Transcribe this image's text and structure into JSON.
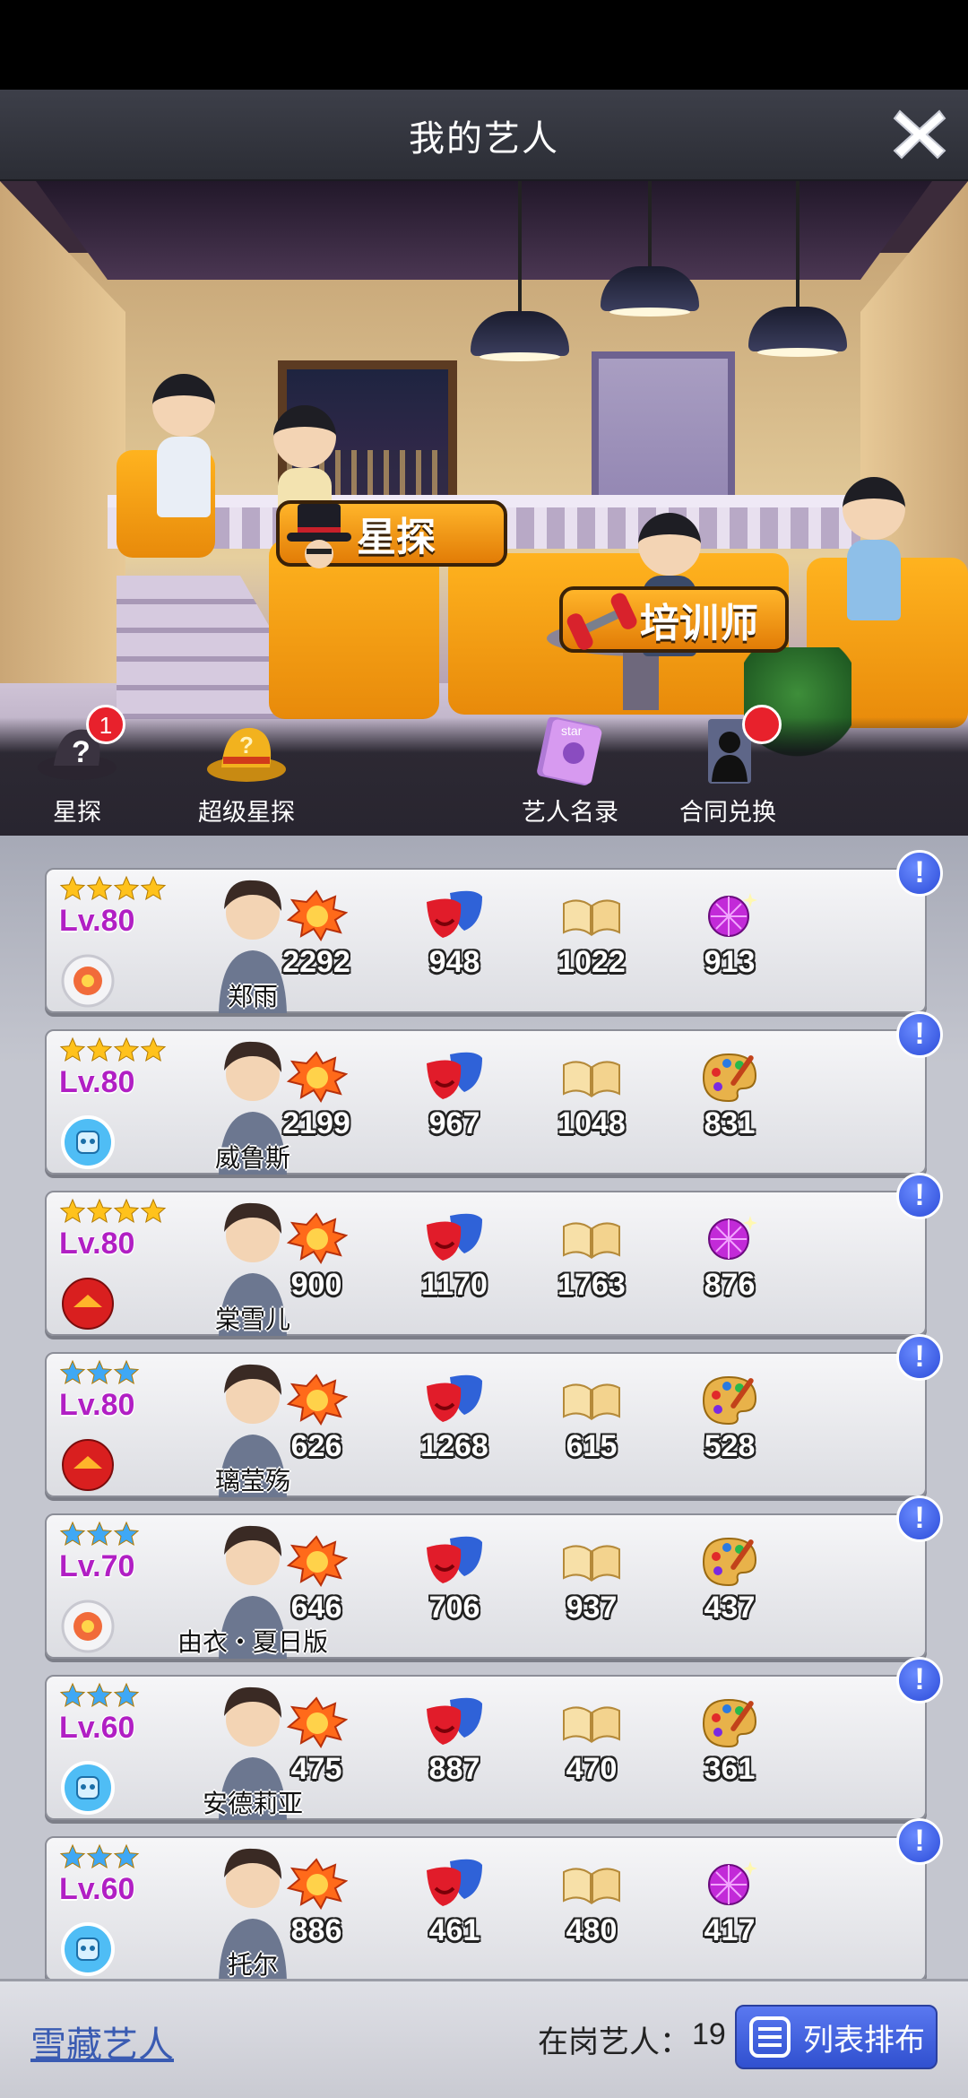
{
  "header": {
    "title": "我的艺人"
  },
  "scene": {
    "signs": [
      {
        "label": "星探",
        "icon": "top-hat-icon"
      },
      {
        "label": "培训师",
        "icon": "dumbbell-icon"
      }
    ]
  },
  "actions": [
    {
      "label": "星探",
      "icon": "question-hat-icon",
      "badge": "1"
    },
    {
      "label": "超级星探",
      "icon": "gold-hat-icon",
      "badge": ""
    },
    {
      "label": "艺人名录",
      "icon": "star-book-icon",
      "badge": ""
    },
    {
      "label": "合同兑换",
      "icon": "silhouette-card-icon",
      "badge": ""
    }
  ],
  "stat_icons": [
    "explosion-icon",
    "drama-mask-icon",
    "open-book-icon",
    "talent-icon"
  ],
  "artists": [
    {
      "name": "郑雨",
      "level": "Lv.80",
      "stars": 4,
      "star_color": "#ffc21c",
      "type": "flower",
      "stats": [
        "2292",
        "948",
        "1022",
        "913"
      ],
      "talent_icon": "disco-ball-icon"
    },
    {
      "name": "威鲁斯",
      "level": "Lv.80",
      "stars": 4,
      "star_color": "#ffc21c",
      "type": "robot",
      "stats": [
        "2199",
        "967",
        "1048",
        "831"
      ],
      "talent_icon": "palette-icon"
    },
    {
      "name": "棠雪儿",
      "level": "Lv.80",
      "stars": 4,
      "star_color": "#ffc21c",
      "type": "red",
      "stats": [
        "900",
        "1170",
        "1763",
        "876"
      ],
      "talent_icon": "disco-ball-icon"
    },
    {
      "name": "璃莹殇",
      "level": "Lv.80",
      "stars": 3,
      "star_color": "#3fa8f5",
      "type": "red",
      "stats": [
        "626",
        "1268",
        "615",
        "528"
      ],
      "talent_icon": "palette-icon"
    },
    {
      "name": "由衣・夏日版",
      "level": "Lv.70",
      "stars": 3,
      "star_color": "#3fa8f5",
      "type": "flower",
      "stats": [
        "646",
        "706",
        "937",
        "437"
      ],
      "talent_icon": "palette-icon"
    },
    {
      "name": "安德莉亚",
      "level": "Lv.60",
      "stars": 3,
      "star_color": "#3fa8f5",
      "type": "robot",
      "stats": [
        "475",
        "887",
        "470",
        "361"
      ],
      "talent_icon": "palette-icon"
    },
    {
      "name": "托尔",
      "level": "Lv.60",
      "stars": 3,
      "star_color": "#3fa8f5",
      "type": "robot",
      "stats": [
        "886",
        "461",
        "480",
        "417"
      ],
      "talent_icon": "disco-ball-icon"
    }
  ],
  "footer": {
    "frozen_link": "雪藏艺人",
    "active_label": "在岗艺人：",
    "active_count": "19",
    "layout_button": "列表排布"
  }
}
